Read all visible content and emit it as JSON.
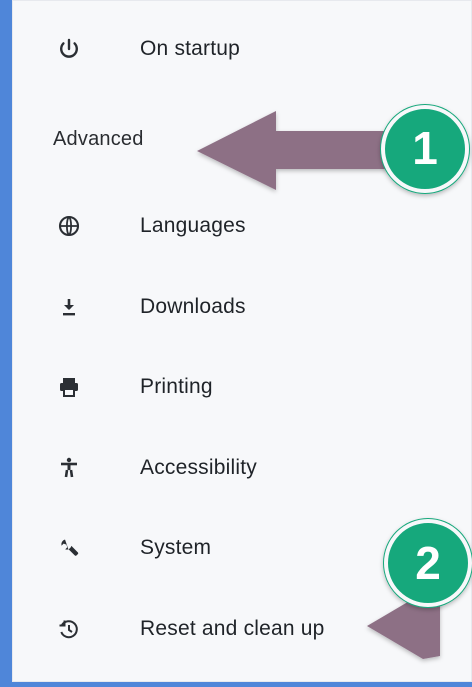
{
  "sidebar": {
    "items": [
      {
        "label": "On startup",
        "icon": "power-icon"
      },
      {
        "label": "Languages",
        "icon": "globe-icon"
      },
      {
        "label": "Downloads",
        "icon": "download-icon"
      },
      {
        "label": "Printing",
        "icon": "printer-icon"
      },
      {
        "label": "Accessibility",
        "icon": "accessibility-icon"
      },
      {
        "label": "System",
        "icon": "wrench-icon"
      },
      {
        "label": "Reset and clean up",
        "icon": "reset-history-icon"
      }
    ],
    "advanced_label": "Advanced"
  },
  "annotations": {
    "badge_1": "1",
    "badge_2": "2",
    "arrow_color": "#8d6f85",
    "badge_color": "#18a87c"
  }
}
